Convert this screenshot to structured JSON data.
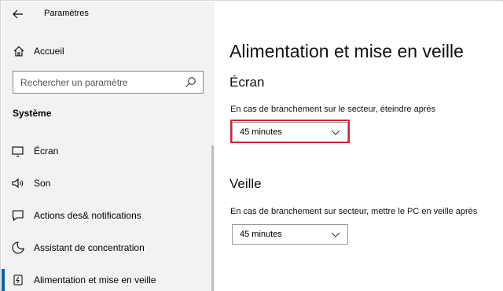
{
  "window": {
    "app_title": "Paramètres"
  },
  "sidebar": {
    "home_label": "Accueil",
    "search_placeholder": "Rechercher un paramètre",
    "section_label": "Système",
    "items": [
      {
        "label": "Écran",
        "icon": "monitor-icon"
      },
      {
        "label": "Son",
        "icon": "speaker-icon"
      },
      {
        "label": "Actions des& notifications",
        "icon": "notification-icon"
      },
      {
        "label": "Assistant de concentration",
        "icon": "moon-icon"
      },
      {
        "label": "Alimentation et mise en veille",
        "icon": "power-icon",
        "active": true
      }
    ]
  },
  "main": {
    "page_title": "Alimentation et mise en veille",
    "screen_section": {
      "title": "Écran",
      "description": "En cas de branchement sur le secteur, éteindre après",
      "value": "45 minutes"
    },
    "sleep_section": {
      "title": "Veille",
      "description": "En cas de branchement sur secteur, mettre le PC en veille après",
      "value": "45 minutes"
    }
  },
  "colors": {
    "accent": "#0063b1",
    "highlight": "#d9232e",
    "sidebar_bg": "#f2f2f2"
  }
}
